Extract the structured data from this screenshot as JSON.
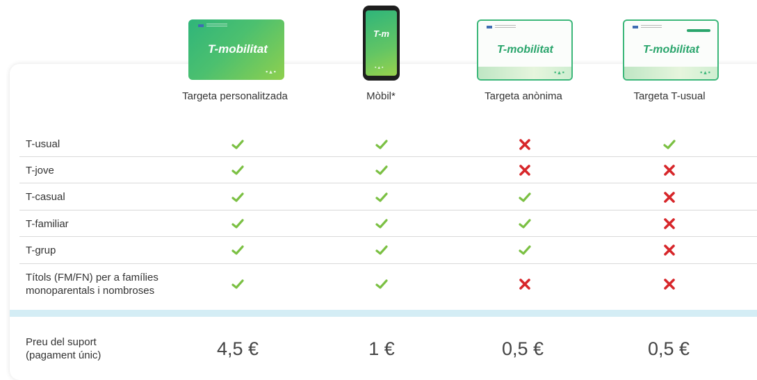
{
  "colors": {
    "check": "#7bc043",
    "cross": "#d7262a",
    "accent": "#3cb77a"
  },
  "columns": [
    {
      "label": "Targeta personalitzada",
      "card_brand": "T-mobilitat"
    },
    {
      "label": "Mòbil*",
      "card_brand": "T-m"
    },
    {
      "label": "Targeta anònima",
      "card_brand": "T-mobilitat"
    },
    {
      "label": "Targeta T-usual",
      "card_brand": "T-mobilitat"
    }
  ],
  "rows": [
    {
      "label": "T-usual",
      "values": [
        "check",
        "check",
        "cross",
        "check"
      ]
    },
    {
      "label": "T-jove",
      "values": [
        "check",
        "check",
        "cross",
        "cross"
      ]
    },
    {
      "label": "T-casual",
      "values": [
        "check",
        "check",
        "check",
        "cross"
      ]
    },
    {
      "label": "T-familiar",
      "values": [
        "check",
        "check",
        "check",
        "cross"
      ]
    },
    {
      "label": "T-grup",
      "values": [
        "check",
        "check",
        "check",
        "cross"
      ]
    },
    {
      "label_line1": "Títols (FM/FN) per a famílies",
      "label_line2": "monoparentals i nombroses",
      "values": [
        "check",
        "check",
        "cross",
        "cross"
      ]
    }
  ],
  "price_row": {
    "label_line1": "Preu del suport",
    "label_line2": "(pagament únic)",
    "values": [
      "4,5 €",
      "1 €",
      "0,5 €",
      "0,5 €"
    ]
  }
}
